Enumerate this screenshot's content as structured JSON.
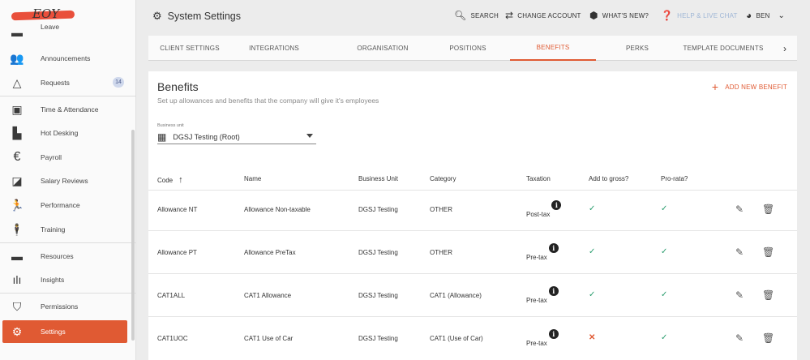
{
  "sidebar": {
    "logo_text": "EOY",
    "items": [
      {
        "label": "Leave",
        "icon": "leave-icon"
      },
      {
        "label": "Announcements",
        "icon": "announcements-icon"
      },
      {
        "label": "Requests",
        "icon": "requests-icon",
        "badge": "14"
      },
      {
        "label": "Time & Attendance",
        "icon": "calendar-icon"
      },
      {
        "label": "Hot Desking",
        "icon": "hot-desking-icon"
      },
      {
        "label": "Payroll",
        "icon": "euro-icon"
      },
      {
        "label": "Salary Reviews",
        "icon": "salary-reviews-icon"
      },
      {
        "label": "Performance",
        "icon": "performance-icon"
      },
      {
        "label": "Training",
        "icon": "training-icon"
      },
      {
        "label": "Resources",
        "icon": "folder-icon"
      },
      {
        "label": "Insights",
        "icon": "insights-icon"
      },
      {
        "label": "Permissions",
        "icon": "shield-icon"
      },
      {
        "label": "Settings",
        "icon": "gear-icon"
      }
    ],
    "active": "Settings"
  },
  "header": {
    "title": "System Settings",
    "search": "SEARCH",
    "change_account": "CHANGE ACCOUNT",
    "whats_new": "WHAT'S NEW?",
    "help": "HELP & LIVE CHAT",
    "user": "BEN"
  },
  "tabs": {
    "items": [
      "CLIENT SETTINGS",
      "INTEGRATIONS",
      "ORGANISATION",
      "POSITIONS",
      "BENEFITS",
      "PERKS",
      "TEMPLATE DOCUMENTS"
    ],
    "active": "BENEFITS"
  },
  "page": {
    "title": "Benefits",
    "subtitle": "Set up allowances and benefits that the company will give it's employees",
    "add_button": "ADD NEW BENEFIT",
    "business_unit_label": "Business unit",
    "business_unit_value": "DGSJ Testing (Root)"
  },
  "table": {
    "columns": [
      "Code",
      "Name",
      "Business Unit",
      "Category",
      "Taxation",
      "Add to gross?",
      "Pro-rata?"
    ],
    "sort_column": "Code",
    "rows": [
      {
        "code": "Allowance NT",
        "name": "Allowance Non-taxable",
        "business_unit": "DGSJ Testing",
        "category": "OTHER",
        "taxation": "Post-tax",
        "add_to_gross": true,
        "pro_rata": true
      },
      {
        "code": "Allowance PT",
        "name": "Allowance PreTax",
        "business_unit": "DGSJ Testing",
        "category": "OTHER",
        "taxation": "Pre-tax",
        "add_to_gross": true,
        "pro_rata": true
      },
      {
        "code": "CAT1ALL",
        "name": "CAT1 Allowance",
        "business_unit": "DGSJ Testing",
        "category": "CAT1 (Allowance)",
        "taxation": "Pre-tax",
        "add_to_gross": true,
        "pro_rata": true
      },
      {
        "code": "CAT1UOC",
        "name": "CAT1 Use of Car",
        "business_unit": "DGSJ Testing",
        "category": "CAT1 (Use of Car)",
        "taxation": "Pre-tax",
        "add_to_gross": false,
        "pro_rata": true
      }
    ]
  },
  "colors": {
    "accent": "#e05a33",
    "check": "#2a9d6e",
    "badge_bg": "#cfd8ec"
  }
}
